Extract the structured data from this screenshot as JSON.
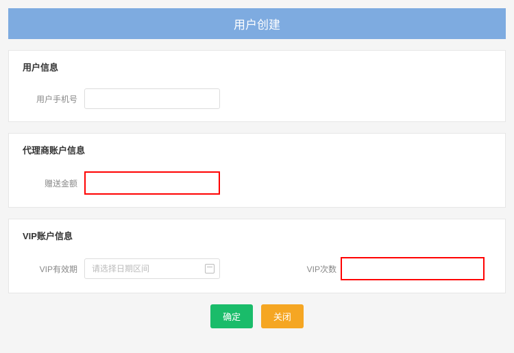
{
  "header": {
    "title": "用户创建"
  },
  "section_user": {
    "title": "用户信息",
    "phone_label": "用户手机号",
    "phone_value": ""
  },
  "section_agent": {
    "title": "代理商账户信息",
    "bonus_label": "赠送金额",
    "bonus_value": ""
  },
  "section_vip": {
    "title": "VIP账户信息",
    "period_label": "VIP有效期",
    "period_value": "",
    "period_placeholder": "请选择日期区间",
    "count_label": "VIP次数",
    "count_value": ""
  },
  "buttons": {
    "confirm_label": "确定",
    "close_label": "关闭"
  }
}
